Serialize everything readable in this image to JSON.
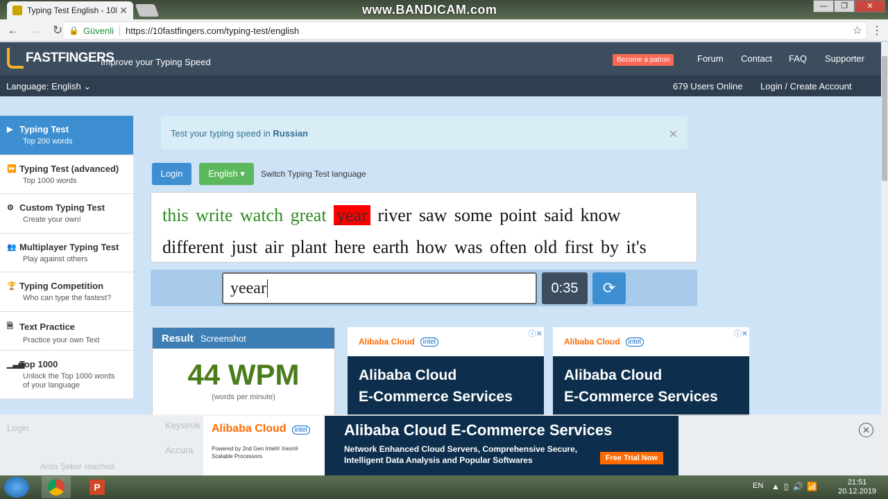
{
  "browser": {
    "tab_title": "Typing Test English - 10F",
    "watermark": "www.BANDICAM.com",
    "secure_label": "Güvenli",
    "url": "https://10fastfingers.com/typing-test/english"
  },
  "header": {
    "logo": "FASTFINGERS",
    "tagline": "Improve your Typing Speed",
    "patron_button": "Become a patron",
    "nav": [
      "Forum",
      "Contact",
      "FAQ",
      "Supporter"
    ],
    "language": "Language: English",
    "users_online": "679 Users Online",
    "login": "Login / Create Account"
  },
  "sidebar": {
    "items": [
      {
        "title": "Typing Test",
        "sub": "Top 200 words",
        "icon": "play-icon"
      },
      {
        "title": "Typing Test (advanced)",
        "sub": "Top 1000 words",
        "icon": "fast-forward-icon"
      },
      {
        "title": "Custom Typing Test",
        "sub": "Create your own!",
        "icon": "gears-icon"
      },
      {
        "title": "Multiplayer Typing Test",
        "sub": "Play against others",
        "icon": "users-icon"
      },
      {
        "title": "Typing Competition",
        "sub": "Who can type the fastest?",
        "icon": "trophy-icon"
      },
      {
        "title": "Text Practice",
        "sub": "Practice your own Text",
        "icon": "document-icon"
      },
      {
        "title": "Top 1000",
        "sub1": "Unlock the Top 1000 words",
        "sub2": "of your language",
        "icon": "signal-icon"
      }
    ]
  },
  "notice": {
    "text": "Test your typing speed in ",
    "language": "Russian"
  },
  "controls": {
    "login": "Login",
    "english": "English",
    "switch_label": "Switch Typing Test language"
  },
  "words": {
    "line1": [
      "this",
      "write",
      "watch",
      "great",
      "year",
      "river",
      "saw",
      "some",
      "point",
      "said",
      "know"
    ],
    "line2": [
      "different",
      "just",
      "air",
      "plant",
      "here",
      "earth",
      "how",
      "was",
      "often",
      "old",
      "first",
      "by",
      "it's"
    ],
    "correct_count": 4,
    "current_index": 4
  },
  "typing": {
    "input_value": "yeear",
    "timer": "0:35"
  },
  "result": {
    "title": "Result",
    "screenshot": "Screenshot",
    "wpm": "44 WPM",
    "wpm_sub": "(words per minute)",
    "hidden_rows": [
      "Keystrok",
      "Accura"
    ]
  },
  "ads": {
    "brand": "Alibaba Cloud",
    "partner": "intel",
    "headline1": "Alibaba Cloud",
    "headline2": "E-Commerce Services",
    "bottom_title": "Alibaba Cloud E-Commerce Services",
    "bottom_desc1": "Network Enhanced Cloud Servers, Comprehensive Secure,",
    "bottom_desc2": "Intelligent Data Analysis and Popular Softwares",
    "powered1": "Powered by 2nd Gen Intel® Xeon®",
    "powered2": "Scalable Processors",
    "cta": "Free Trial Now",
    "ghost_login": "Login",
    "ghost_user": "Arda Şeker reached"
  },
  "taskbar": {
    "lang": "EN",
    "time": "21:51",
    "date": "20.12.2019"
  }
}
